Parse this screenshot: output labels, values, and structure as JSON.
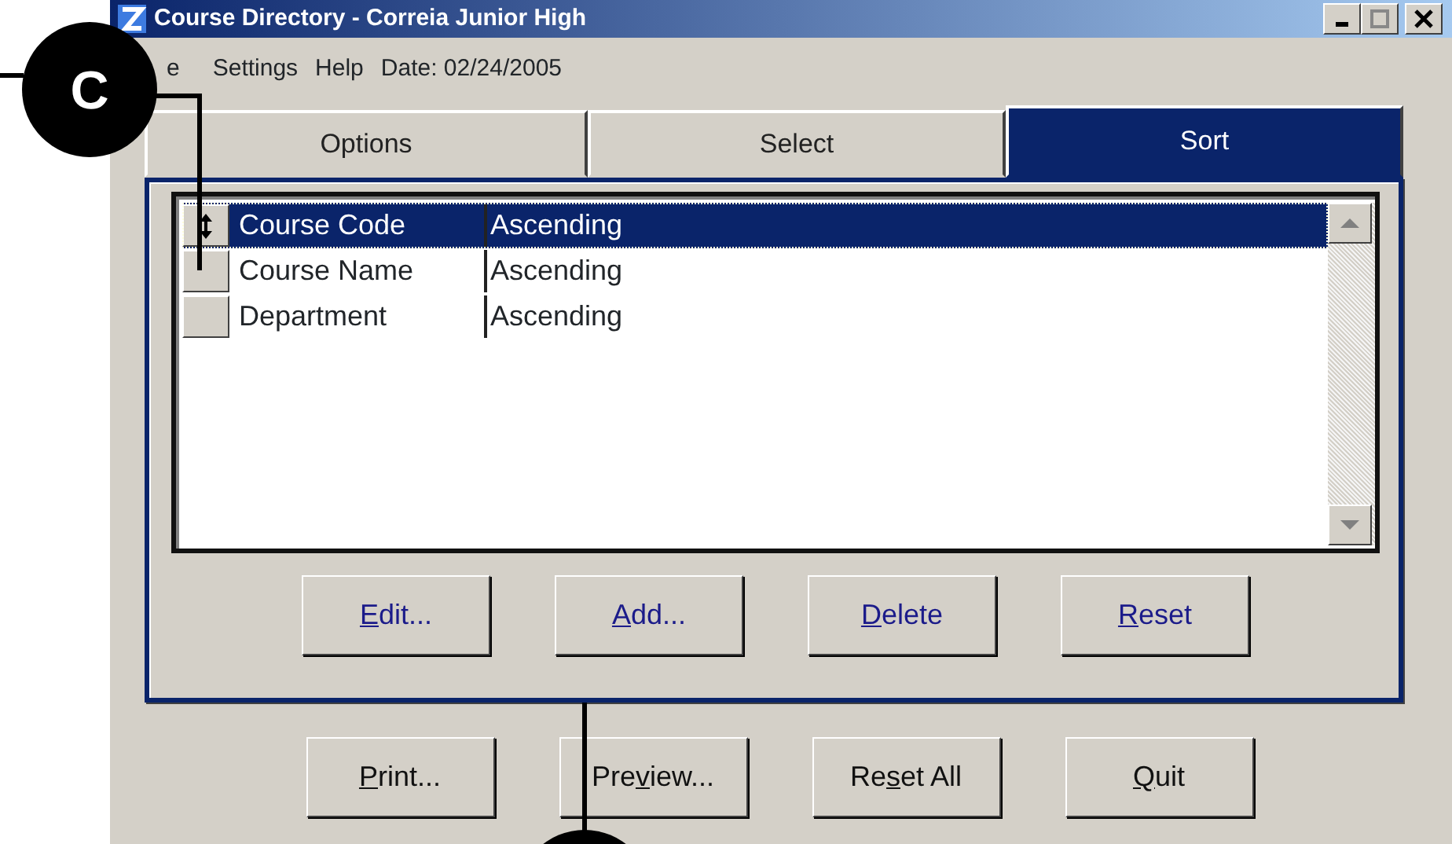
{
  "window": {
    "title": "Course Directory - Correia Junior High"
  },
  "menu": [
    {
      "label": "e"
    },
    {
      "label": "Settings"
    },
    {
      "label": "Help"
    }
  ],
  "date": "Date: 02/24/2005",
  "tabs": [
    {
      "label": "Options",
      "selected": false
    },
    {
      "label": "Select",
      "selected": false
    },
    {
      "label": "Sort",
      "selected": true
    }
  ],
  "sort_list": {
    "rows": [
      {
        "field": "Course Code",
        "order": "Ascending",
        "selected": true
      },
      {
        "field": "Course Name",
        "order": "Ascending",
        "selected": false
      },
      {
        "field": "Department",
        "order": "Ascending",
        "selected": false
      }
    ]
  },
  "panel_buttons": [
    {
      "key": "E",
      "post": "dit..."
    },
    {
      "key": "A",
      "post": "dd..."
    },
    {
      "key": "D",
      "post": "elete"
    },
    {
      "key": "R",
      "post": "eset"
    }
  ],
  "bottom_buttons": [
    {
      "key": "P",
      "post": "rint..."
    },
    {
      "pre": "Pre",
      "key": "v",
      "post": "iew..."
    },
    {
      "pre": "Re",
      "key": "s",
      "post": "et All"
    },
    {
      "key": "Q",
      "post": "uit"
    }
  ],
  "callouts": [
    {
      "kind": "labeled",
      "label": "C"
    },
    {
      "kind": "plain"
    }
  ]
}
